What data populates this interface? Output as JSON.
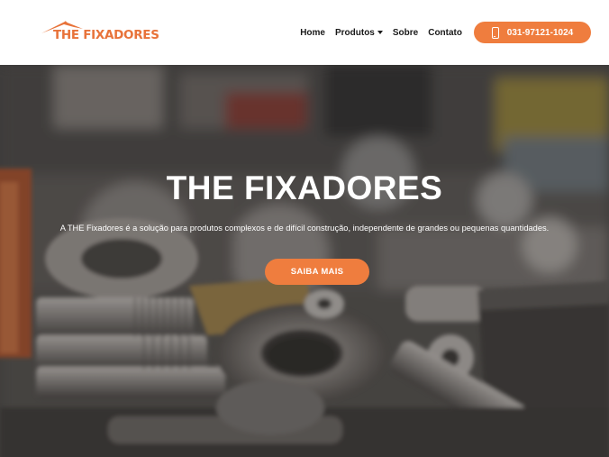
{
  "brand": {
    "logo_text": "THE FIXADORES",
    "accent_color": "#ef7d3e",
    "logo_color": "#e8733a"
  },
  "nav": {
    "items": [
      {
        "label": "Home"
      },
      {
        "label": "Produtos",
        "has_dropdown": true
      },
      {
        "label": "Sobre"
      },
      {
        "label": "Contato"
      }
    ],
    "phone_label": "031-97121-1024",
    "phone_icon": "smartphone-icon"
  },
  "hero": {
    "title": "THE FIXADORES",
    "subtitle": "A THE Fixadores é a solução para produtos complexos e de difícil construção, independente de grandes ou pequenas quantidades.",
    "cta_label": "SAIBA MAIS",
    "background": "blurred-hardware-screws-bolts-photo"
  }
}
